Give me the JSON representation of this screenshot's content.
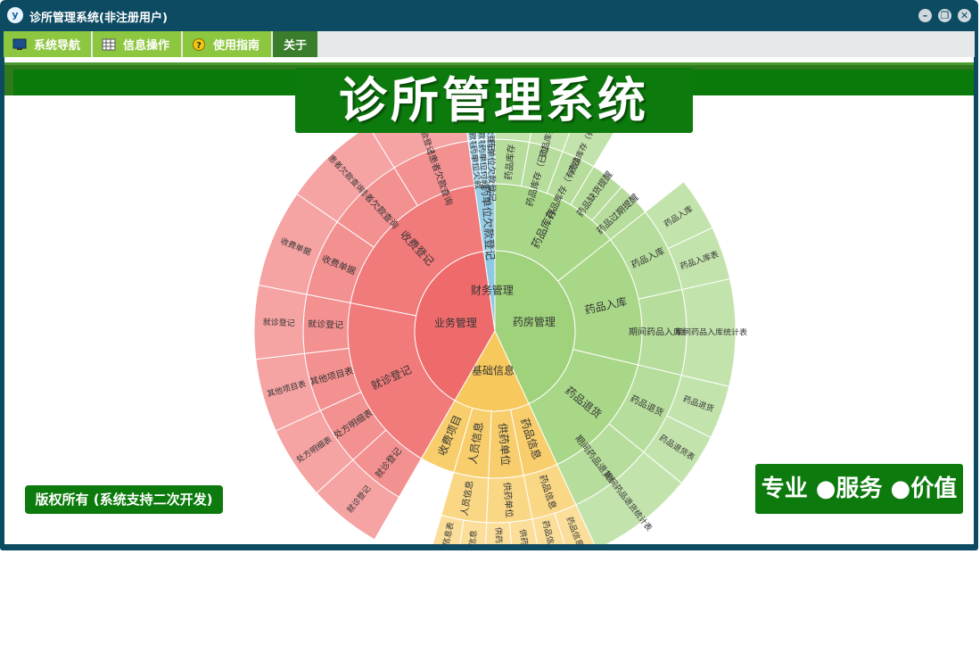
{
  "window": {
    "title": "诊所管理系统(非注册用户)",
    "app_icon": "y"
  },
  "menu": [
    {
      "label": "系统导航",
      "icon": "monitor-icon"
    },
    {
      "label": "信息操作",
      "icon": "grid-icon"
    },
    {
      "label": "使用指南",
      "icon": "help-icon"
    },
    {
      "label": "关于",
      "icon": ""
    }
  ],
  "banner": "诊所管理系统",
  "copyright": "版权所有 (系统支持二次开发)",
  "slogan": "专业 ●服务 ●价值",
  "colors": {
    "pharmacy": "#9fd27b",
    "finance": "#8ec9e4",
    "business": "#ef6b6b",
    "basic": "#f7c95c"
  },
  "sunburst": [
    {
      "label": "药房管理",
      "color": "pharmacy",
      "children": [
        {
          "label": "药品库存",
          "children": [
            {
              "label": "药品库存",
              "leaves": [
                "药品库存"
              ]
            },
            {
              "label": "药品库存（已过期）",
              "leaves": [
                "药品库存（已过期）"
              ]
            },
            {
              "label": "药品库存（有效期内）",
              "leaves": [
                "药品库存（有效期内）"
              ]
            },
            {
              "label": "药品缺货提醒",
              "leaves": []
            },
            {
              "label": "药品过期提醒",
              "leaves": []
            }
          ]
        },
        {
          "label": "药品入库",
          "children": [
            {
              "label": "药品入库",
              "leaves": [
                "药品入库",
                "药品入库表"
              ]
            },
            {
              "label": "期间药品入库统计",
              "leaves": [
                "期间药品入库统计表"
              ]
            }
          ]
        },
        {
          "label": "药品退货",
          "children": [
            {
              "label": "药品退货",
              "leaves": [
                "药品退货",
                "药品退货表"
              ]
            },
            {
              "label": "期间药品退货统计",
              "leaves": [
                "期间药品退货统计表"
              ]
            }
          ]
        }
      ]
    },
    {
      "label": "基础信息",
      "color": "basic",
      "children": [
        {
          "label": "药品信息",
          "children": [
            {
              "label": "药品信息",
              "leaves": [
                "药品信息",
                "药品信息表"
              ]
            }
          ]
        },
        {
          "label": "供药单位",
          "children": [
            {
              "label": "供药单位",
              "leaves": [
                "供药单位",
                "供药单位表"
              ]
            }
          ]
        },
        {
          "label": "人员信息",
          "children": [
            {
              "label": "人员信息",
              "leaves": [
                "人员信息",
                "人员信息表"
              ]
            }
          ]
        },
        {
          "label": "收费项目",
          "children": []
        }
      ]
    },
    {
      "label": "业务管理",
      "color": "business",
      "children": [
        {
          "label": "就诊登记",
          "children": [
            {
              "label": "就诊登记",
              "leaves": [
                "就诊登记"
              ]
            },
            {
              "label": "处方明细表",
              "leaves": [
                "处方明细表"
              ]
            },
            {
              "label": "其他项目表",
              "leaves": [
                "其他项目表"
              ]
            },
            {
              "label": "就诊登记",
              "leaves": [
                "就诊登记"
              ]
            }
          ]
        },
        {
          "label": "收费登记",
          "children": [
            {
              "label": "收费单据",
              "leaves": [
                "收费单据"
              ]
            },
            {
              "label": "患者欠款查询",
              "leaves": [
                "患者欠款查询"
              ]
            },
            {
              "label": "期间患者欠款查询",
              "leaves": [
                "患者付欠款登记"
              ]
            }
          ]
        }
      ]
    },
    {
      "label": "财务管理",
      "color": "finance",
      "children": [
        {
          "label": "供药单位欠款登记",
          "children": [
            {
              "label": "供药单位欠款",
              "leaves": [
                "供药单位欠款"
              ]
            },
            {
              "label": "供药单位付款",
              "leaves": [
                "供药单位付款"
              ]
            },
            {
              "label": "付供药单位欠款登记",
              "leaves": [
                "付供药单位欠款登记"
              ]
            }
          ]
        }
      ]
    }
  ]
}
